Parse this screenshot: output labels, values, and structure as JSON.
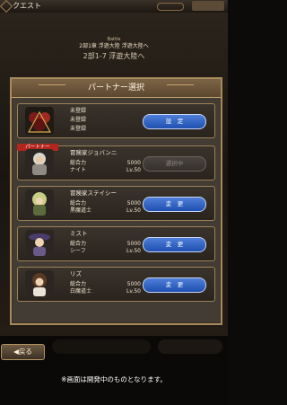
{
  "topbar": {
    "title": "クエスト"
  },
  "quest": {
    "label": "Battle",
    "subtitle": "2部1章 浮遊大陸 浮遊大陸へ",
    "name": "2部1-7 浮遊大陸へ"
  },
  "modal": {
    "title": "パートナー選択",
    "cards": [
      {
        "unregistered": [
          "未登録",
          "未登録",
          "未登録"
        ],
        "button": "設　定",
        "button_enabled": true
      },
      {
        "tag": "パートナー",
        "name": "冒険家ジョバンニ",
        "power_label": "総合力",
        "power": "5000",
        "job": "ナイト",
        "level": "Lv.50",
        "button": "選択中",
        "button_enabled": false
      },
      {
        "name": "冒険家ステイシー",
        "power_label": "総合力",
        "power": "5000",
        "job": "黒魔道士",
        "level": "Lv.50",
        "button": "変　更",
        "button_enabled": true
      },
      {
        "name": "ミスト",
        "power_label": "総合力",
        "power": "5000",
        "job": "シーフ",
        "level": "Lv.50",
        "button": "変　更",
        "button_enabled": true
      },
      {
        "name": "リズ",
        "power_label": "総合力",
        "power": "5000",
        "job": "白魔道士",
        "level": "Lv.50",
        "button": "変　更",
        "button_enabled": true
      }
    ]
  },
  "back_button": "◀戻る",
  "notice": "※画面は開発中のものとなります。"
}
